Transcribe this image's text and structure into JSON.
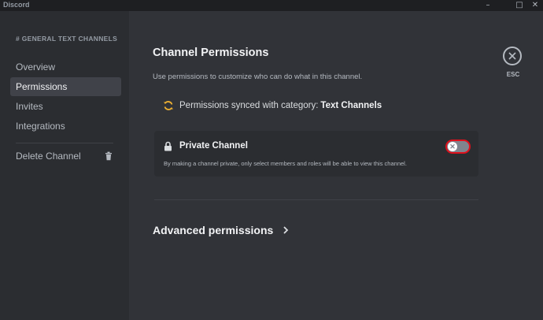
{
  "window": {
    "title": "Discord",
    "controls": [
      "–",
      "□",
      "✕"
    ]
  },
  "sidebar": {
    "header": "# GENERAL TEXT CHANNELS",
    "items": [
      {
        "label": "Overview"
      },
      {
        "label": "Permissions"
      },
      {
        "label": "Invites"
      },
      {
        "label": "Integrations"
      }
    ],
    "delete_label": "Delete Channel"
  },
  "main": {
    "title": "Channel Permissions",
    "description": "Use permissions to customize who can do what in this channel.",
    "sync": {
      "text": "Permissions synced with category:",
      "category": "Text Channels"
    },
    "private_channel": {
      "title": "Private Channel",
      "description": "By making a channel private, only select members and roles will be able to view this channel.",
      "enabled": false
    },
    "advanced": {
      "label": "Advanced permissions"
    }
  },
  "close": {
    "label": "ESC"
  },
  "colors": {
    "background": "#313338",
    "sidebar": "#2b2d31",
    "titlebar": "#1e1f22",
    "highlight": "#e0101c",
    "sync_icon": "#f0b232"
  }
}
